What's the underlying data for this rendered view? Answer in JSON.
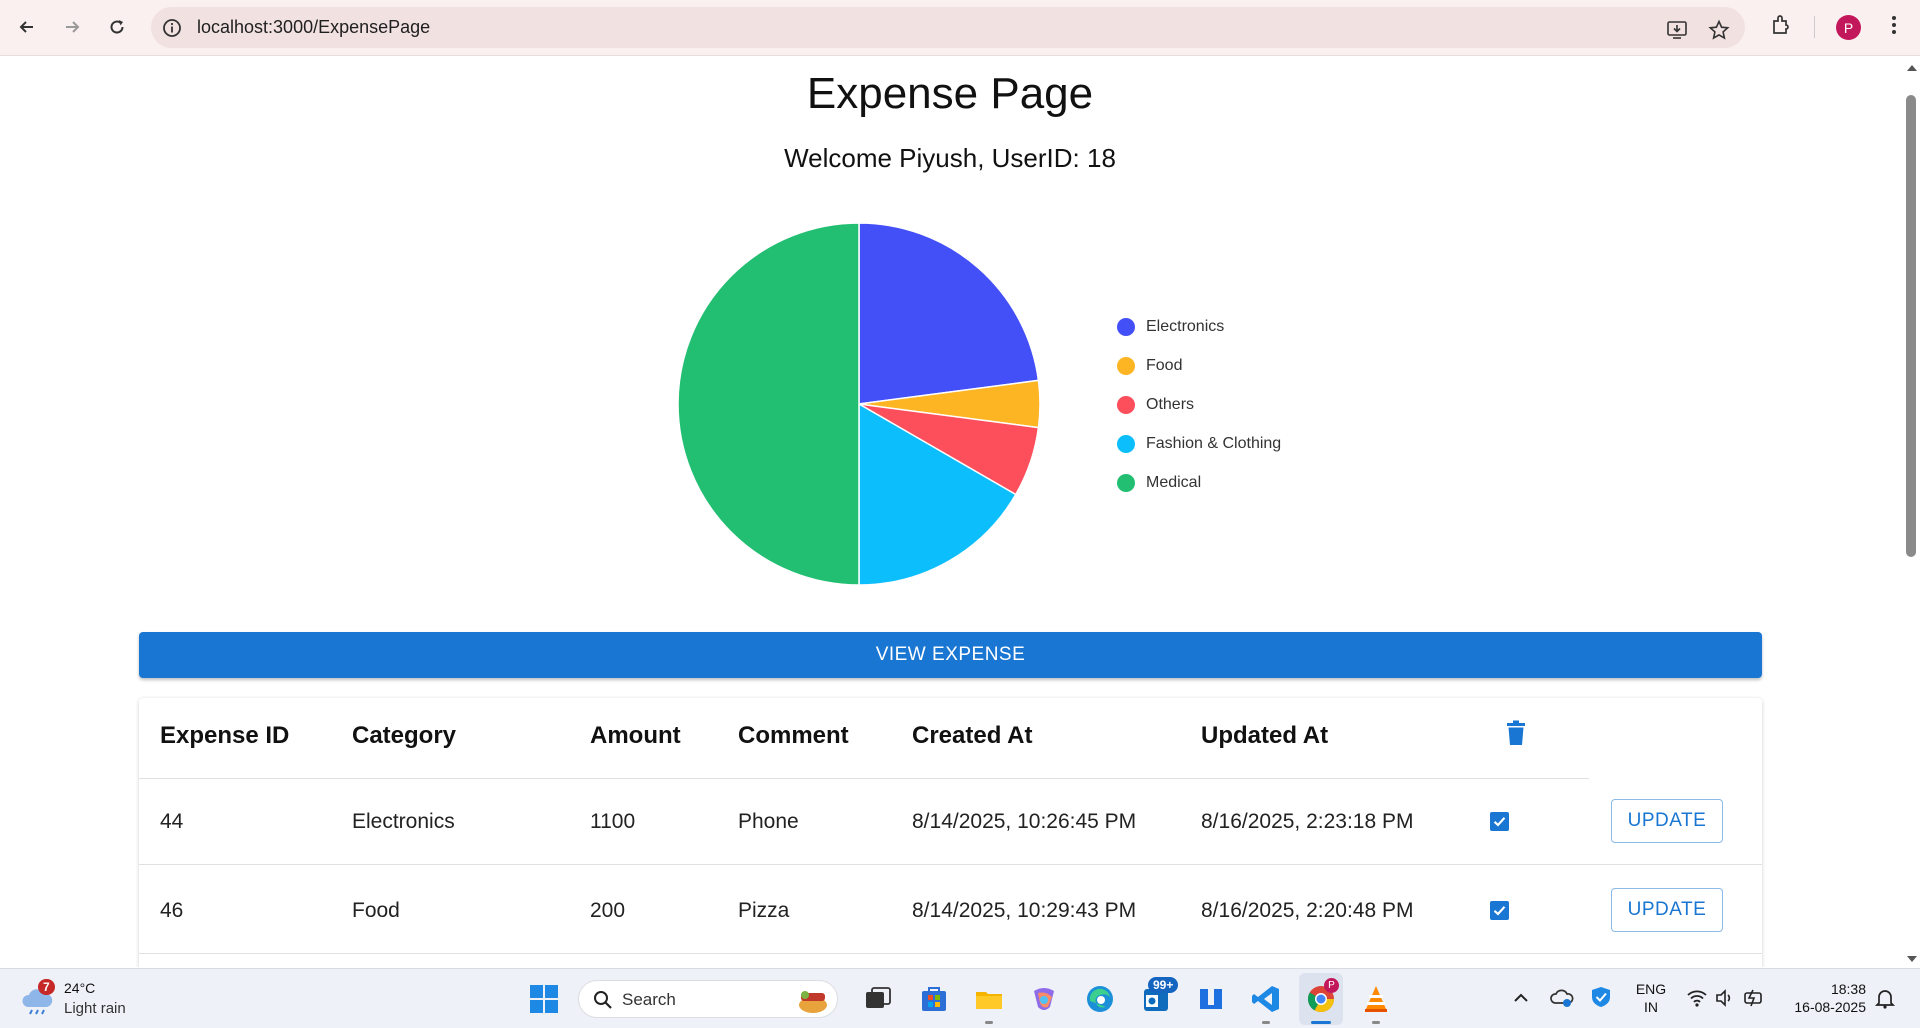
{
  "browser": {
    "url": "localhost:3000/ExpensePage",
    "profile_initial": "P"
  },
  "page": {
    "title": "Expense Page",
    "welcome": "Welcome Piyush, UserID: 18"
  },
  "chart_data": {
    "type": "pie",
    "title": "",
    "legend_position": "right",
    "categories": [
      "Electronics",
      "Food",
      "Others",
      "Fashion & Clothing",
      "Medical"
    ],
    "values": [
      1100,
      200,
      300,
      800,
      2400
    ],
    "colors": [
      "#4450f7",
      "#fdb523",
      "#fd4e5c",
      "#0dbefc",
      "#22bf73"
    ]
  },
  "view_button": "VIEW EXPENSE",
  "table": {
    "headers": [
      "Expense ID",
      "Category",
      "Amount",
      "Comment",
      "Created At",
      "Updated At"
    ],
    "delete_icon": "trash-icon",
    "rows": [
      {
        "id": "44",
        "category": "Electronics",
        "amount": "1100",
        "comment": "Phone",
        "created": "8/14/2025, 10:26:45 PM",
        "updated": "8/16/2025, 2:23:18 PM",
        "checked": true,
        "action": "UPDATE"
      },
      {
        "id": "46",
        "category": "Food",
        "amount": "200",
        "comment": "Pizza",
        "created": "8/14/2025, 10:29:43 PM",
        "updated": "8/16/2025, 2:20:48 PM",
        "checked": true,
        "action": "UPDATE"
      }
    ]
  },
  "taskbar": {
    "weather_temp": "24°C",
    "weather_desc": "Light rain",
    "weather_badge": "7",
    "search_label": "Search",
    "mail_badge": "99+",
    "lang_top": "ENG",
    "lang_bottom": "IN",
    "time": "18:38",
    "date": "16-08-2025"
  }
}
